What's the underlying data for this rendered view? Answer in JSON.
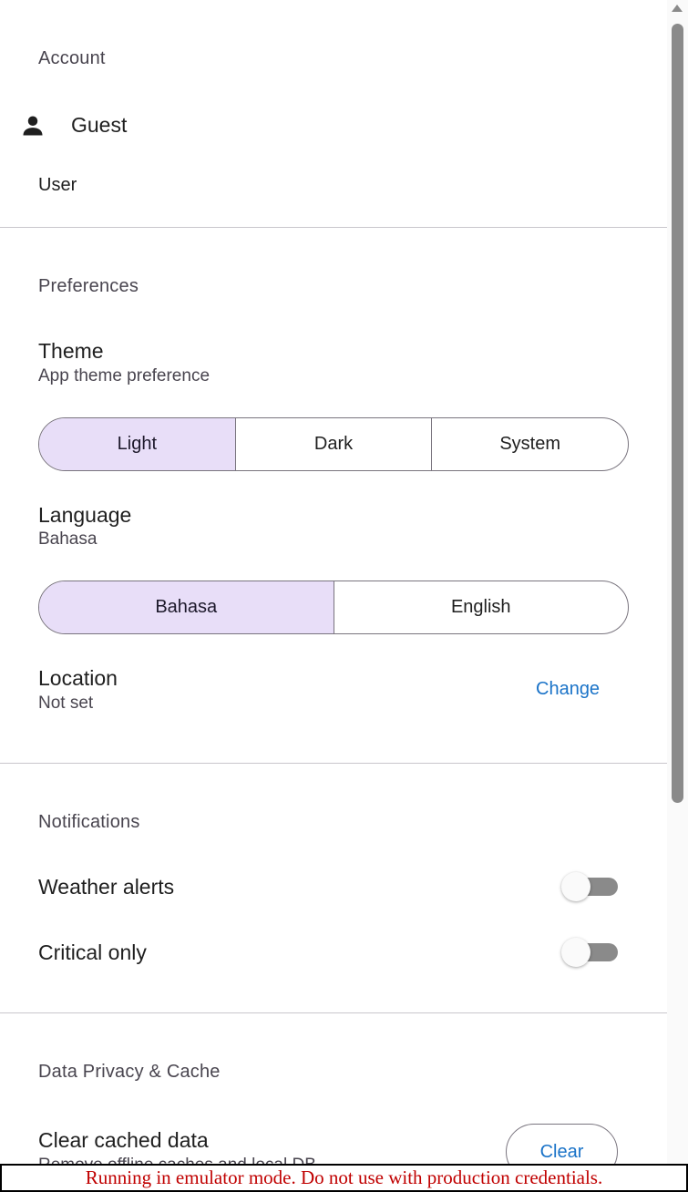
{
  "account": {
    "section_title": "Account",
    "user_name": "Guest",
    "user_role": "User",
    "icon": "person-icon"
  },
  "preferences": {
    "section_title": "Preferences",
    "theme": {
      "title": "Theme",
      "subtitle": "App theme preference",
      "options": [
        "Light",
        "Dark",
        "System"
      ],
      "selected": "Light"
    },
    "language": {
      "title": "Language",
      "subtitle": "Bahasa",
      "options": [
        "Bahasa",
        "English"
      ],
      "selected": "Bahasa"
    },
    "location": {
      "title": "Location",
      "subtitle": "Not set",
      "action_label": "Change"
    }
  },
  "notifications": {
    "section_title": "Notifications",
    "weather_alerts": {
      "label": "Weather alerts",
      "enabled": false
    },
    "critical_only": {
      "label": "Critical only",
      "enabled": false
    }
  },
  "data_privacy": {
    "section_title": "Data Privacy & Cache",
    "clear_cache": {
      "title": "Clear cached data",
      "subtitle": "Remove offline caches and local DB",
      "action_label": "Clear"
    }
  },
  "banner": {
    "text": "Running in emulator mode. Do not use with production credentials."
  },
  "colors": {
    "accent": "#1a73c8",
    "selected_segment": "#e8def8",
    "banner_text": "#c00000"
  }
}
